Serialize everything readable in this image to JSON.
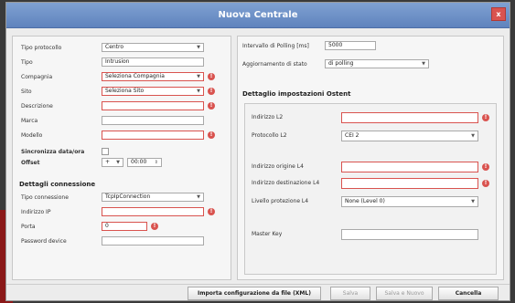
{
  "window": {
    "title": "Nuova Centrale",
    "close_label": "x"
  },
  "left": {
    "rows": [
      {
        "label": "Tipo protocollo",
        "value": "Centro",
        "kind": "select",
        "error": false
      },
      {
        "label": "Tipo",
        "value": "Intrusion",
        "kind": "input",
        "error": false
      },
      {
        "label": "Compagnia",
        "value": "Seleziona Compagnia",
        "kind": "select",
        "error": true
      },
      {
        "label": "Sito",
        "value": "Seleziona Sito",
        "kind": "select",
        "error": true
      },
      {
        "label": "Descrizione",
        "value": "",
        "kind": "input",
        "error": true
      },
      {
        "label": "Marca",
        "value": "",
        "kind": "input",
        "error": false
      },
      {
        "label": "Modello",
        "value": "",
        "kind": "input",
        "error": true
      }
    ],
    "monitor_label": "Sincronizza data/ora",
    "offset_label": "Offset",
    "offset_sign": "+",
    "offset_value": "00:00",
    "section2_title": "Dettagli connessione",
    "conn_rows": [
      {
        "label": "Tipo connessione",
        "value": "TcpIpConnection",
        "kind": "select",
        "error": false
      },
      {
        "label": "Indirizzo IP",
        "value": "",
        "kind": "input",
        "error": true
      },
      {
        "label": "Porta",
        "value": "0",
        "kind": "input",
        "error": true
      },
      {
        "label": "Password device",
        "value": "",
        "kind": "input",
        "error": false
      }
    ]
  },
  "right": {
    "polling_label": "Intervallo di Polling [ms]",
    "polling_value": "5000",
    "update_label": "Aggiornamento di stato",
    "update_value": "di polling",
    "section_title": "Dettaglio impostazioni Ostent",
    "rows": [
      {
        "label": "Indirizzo L2",
        "value": "",
        "kind": "input",
        "error": true
      },
      {
        "label": "Protocollo L2",
        "value": "CEI 2",
        "kind": "select",
        "error": false
      },
      {
        "label": "Indirizzo origine L4",
        "value": "",
        "kind": "input",
        "error": true
      },
      {
        "label": "Indirizzo destinazione L4",
        "value": "",
        "kind": "input",
        "error": true
      },
      {
        "label": "Livello protezione L4",
        "value": "None (Level 0)",
        "kind": "select",
        "error": false
      },
      {
        "label": "Master Key",
        "value": "",
        "kind": "input",
        "error": false
      }
    ]
  },
  "footer": {
    "import_label": "Importa configurazione da file (XML)",
    "save_label": "Salva",
    "save_new_label": "Salva e Nuovo",
    "cancel_label": "Cancella"
  }
}
